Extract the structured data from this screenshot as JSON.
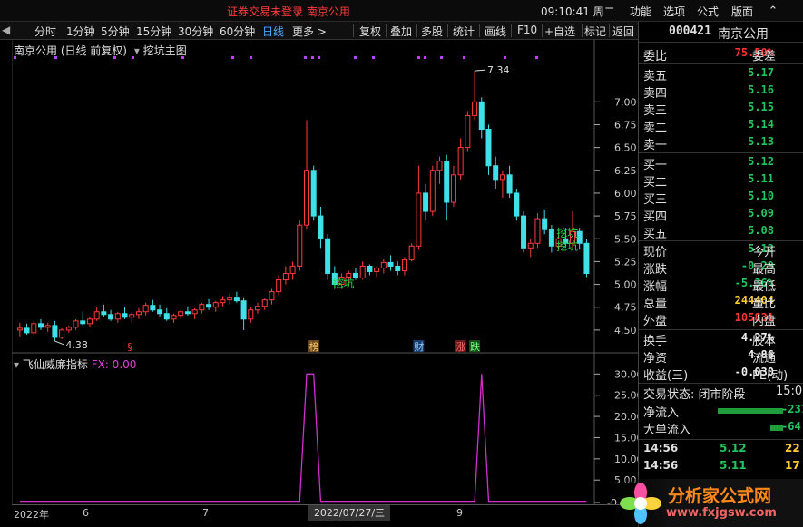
{
  "top": {
    "login_status": "证券交易未登录  南京公用",
    "clock": "09:10:41 周二",
    "menus": [
      "功能",
      "选项",
      "公式",
      "版面"
    ],
    "window_controls": [
      "chevron-up-icon",
      "minimize-icon",
      "maximize-icon",
      "close-icon"
    ]
  },
  "toolbar": {
    "periods": [
      "分时",
      "1分钟",
      "5分钟",
      "15分钟",
      "30分钟",
      "60分钟",
      "日线",
      "更多 >"
    ],
    "active_period": "日线",
    "actions": [
      "复权",
      "叠加",
      "多股",
      "统计",
      "画线",
      "F10",
      "+自选",
      "标记",
      "返回"
    ]
  },
  "chart_header": {
    "title": "南京公用 (日线 前复权)",
    "indicator": "挖坑主图"
  },
  "sub_panel": {
    "name": "飞仙威廉指标",
    "fx_label": "FX: 0.00"
  },
  "chart_data": [
    {
      "type": "candlestick",
      "title": "南京公用 (日线 前复权)",
      "price_ticks": [
        7.0,
        6.75,
        6.5,
        6.25,
        6.0,
        5.75,
        5.5,
        5.25,
        5.0,
        4.75,
        4.5
      ],
      "ylim": [
        4.3,
        7.5
      ],
      "max_annotation": "7.34",
      "min_annotation": "4.38",
      "signal_label": "挖坑",
      "marker_labels": [
        "§",
        "榜",
        "财",
        "涨",
        "跌"
      ],
      "ohlc": [
        [
          4.5,
          4.58,
          4.43,
          4.52
        ],
        [
          4.52,
          4.57,
          4.45,
          4.47
        ],
        [
          4.47,
          4.6,
          4.45,
          4.57
        ],
        [
          4.57,
          4.62,
          4.5,
          4.53
        ],
        [
          4.53,
          4.58,
          4.48,
          4.55
        ],
        [
          4.55,
          4.6,
          4.38,
          4.42
        ],
        [
          4.42,
          4.52,
          4.4,
          4.5
        ],
        [
          4.5,
          4.55,
          4.47,
          4.53
        ],
        [
          4.53,
          4.62,
          4.5,
          4.6
        ],
        [
          4.6,
          4.7,
          4.55,
          4.57
        ],
        [
          4.57,
          4.65,
          4.53,
          4.62
        ],
        [
          4.62,
          4.75,
          4.6,
          4.7
        ],
        [
          4.7,
          4.78,
          4.65,
          4.67
        ],
        [
          4.67,
          4.72,
          4.6,
          4.62
        ],
        [
          4.62,
          4.7,
          4.58,
          4.68
        ],
        [
          4.68,
          4.75,
          4.62,
          4.64
        ],
        [
          4.64,
          4.7,
          4.58,
          4.67
        ],
        [
          4.67,
          4.74,
          4.62,
          4.7
        ],
        [
          4.7,
          4.8,
          4.66,
          4.77
        ],
        [
          4.77,
          4.83,
          4.7,
          4.72
        ],
        [
          4.72,
          4.78,
          4.65,
          4.68
        ],
        [
          4.68,
          4.74,
          4.6,
          4.62
        ],
        [
          4.62,
          4.68,
          4.58,
          4.66
        ],
        [
          4.66,
          4.72,
          4.62,
          4.7
        ],
        [
          4.7,
          4.76,
          4.66,
          4.68
        ],
        [
          4.68,
          4.74,
          4.62,
          4.72
        ],
        [
          4.72,
          4.8,
          4.68,
          4.78
        ],
        [
          4.78,
          4.84,
          4.72,
          4.75
        ],
        [
          4.75,
          4.82,
          4.7,
          4.8
        ],
        [
          4.8,
          4.87,
          4.76,
          4.83
        ],
        [
          4.83,
          4.9,
          4.78,
          4.86
        ],
        [
          4.86,
          4.92,
          4.8,
          4.82
        ],
        [
          4.82,
          4.86,
          4.5,
          4.62
        ],
        [
          4.62,
          4.75,
          4.58,
          4.72
        ],
        [
          4.72,
          4.8,
          4.68,
          4.76
        ],
        [
          4.76,
          4.85,
          4.72,
          4.83
        ],
        [
          4.83,
          4.95,
          4.78,
          4.92
        ],
        [
          4.92,
          5.1,
          4.88,
          5.05
        ],
        [
          5.05,
          5.2,
          5.0,
          5.12
        ],
        [
          5.12,
          5.25,
          5.05,
          5.2
        ],
        [
          5.2,
          5.7,
          5.15,
          5.65
        ],
        [
          5.65,
          6.8,
          5.6,
          6.25
        ],
        [
          6.25,
          6.3,
          5.7,
          5.75
        ],
        [
          5.75,
          5.85,
          5.4,
          5.5
        ],
        [
          5.5,
          5.55,
          5.05,
          5.12
        ],
        [
          5.12,
          5.2,
          4.95,
          5.0
        ],
        [
          5.0,
          5.12,
          4.95,
          5.08
        ],
        [
          5.08,
          5.15,
          5.02,
          5.12
        ],
        [
          5.12,
          5.18,
          5.05,
          5.07
        ],
        [
          5.07,
          5.25,
          5.05,
          5.2
        ],
        [
          5.2,
          5.22,
          5.1,
          5.14
        ],
        [
          5.14,
          5.2,
          5.08,
          5.18
        ],
        [
          5.18,
          5.28,
          5.12,
          5.24
        ],
        [
          5.24,
          5.32,
          5.15,
          5.2
        ],
        [
          5.2,
          5.25,
          5.1,
          5.15
        ],
        [
          5.15,
          5.3,
          5.1,
          5.27
        ],
        [
          5.27,
          5.45,
          5.25,
          5.42
        ],
        [
          5.42,
          6.3,
          5.38,
          6.0
        ],
        [
          6.0,
          6.1,
          5.7,
          5.8
        ],
        [
          5.8,
          6.3,
          5.75,
          6.25
        ],
        [
          6.25,
          6.4,
          6.1,
          6.35
        ],
        [
          6.35,
          6.42,
          5.7,
          5.9
        ],
        [
          5.9,
          6.3,
          5.85,
          6.2
        ],
        [
          6.2,
          6.6,
          6.15,
          6.5
        ],
        [
          6.5,
          6.9,
          6.45,
          6.85
        ],
        [
          6.85,
          7.34,
          6.8,
          7.0
        ],
        [
          7.0,
          7.05,
          6.6,
          6.7
        ],
        [
          6.7,
          6.75,
          6.2,
          6.3
        ],
        [
          6.3,
          6.4,
          6.05,
          6.15
        ],
        [
          6.15,
          6.25,
          5.95,
          6.2
        ],
        [
          6.2,
          6.3,
          5.95,
          6.0
        ],
        [
          6.0,
          6.05,
          5.7,
          5.75
        ],
        [
          5.75,
          5.8,
          5.35,
          5.4
        ],
        [
          5.4,
          5.5,
          5.3,
          5.45
        ],
        [
          5.45,
          5.78,
          5.4,
          5.72
        ],
        [
          5.72,
          5.82,
          5.55,
          5.6
        ],
        [
          5.6,
          5.65,
          5.35,
          5.42
        ],
        [
          5.42,
          5.55,
          5.38,
          5.5
        ],
        [
          5.5,
          5.62,
          5.4,
          5.45
        ],
        [
          5.45,
          5.8,
          5.4,
          5.58
        ],
        [
          5.58,
          5.62,
          5.38,
          5.45
        ],
        [
          5.45,
          5.5,
          5.08,
          5.12
        ]
      ]
    },
    {
      "type": "line",
      "title": "飞仙威廉指标",
      "series_label": "FX: 0.00",
      "y_ticks": [
        30.0,
        25.0,
        20.0,
        15.0,
        10.0,
        5.0,
        -0.3
      ],
      "ylim": [
        -0.3,
        30.5
      ],
      "values": [
        0,
        0,
        0,
        0,
        0,
        0,
        0,
        0,
        0,
        0,
        0,
        0,
        0,
        0,
        0,
        0,
        0,
        0,
        0,
        0,
        0,
        0,
        0,
        0,
        0,
        0,
        0,
        0,
        0,
        0,
        0,
        0,
        0,
        0,
        0,
        0,
        0,
        0,
        0,
        0,
        0,
        30,
        30,
        0,
        0,
        0,
        0,
        0,
        0,
        0,
        0,
        0,
        0,
        0,
        0,
        0,
        0,
        0,
        0,
        0,
        0,
        0,
        0,
        0,
        0,
        0,
        30,
        0,
        0,
        0,
        0,
        0,
        0,
        0,
        0,
        0,
        0,
        0,
        0,
        0,
        0,
        0
      ]
    }
  ],
  "x_axis": {
    "labels": [
      "2022年",
      "6",
      "7",
      "2022/07/27/三",
      "9"
    ]
  },
  "right_panel": {
    "code": "000421",
    "name": "南京公用",
    "weibi_label": "委比",
    "weibi_value": "75.50%",
    "weicha_label": "委差",
    "asks": [
      {
        "label": "卖五",
        "price": "5.17"
      },
      {
        "label": "卖四",
        "price": "5.16"
      },
      {
        "label": "卖三",
        "price": "5.15"
      },
      {
        "label": "卖二",
        "price": "5.14"
      },
      {
        "label": "卖一",
        "price": "5.13"
      }
    ],
    "bids": [
      {
        "label": "买一",
        "price": "5.12"
      },
      {
        "label": "买二",
        "price": "5.11"
      },
      {
        "label": "买三",
        "price": "5.10"
      },
      {
        "label": "买四",
        "price": "5.09"
      },
      {
        "label": "买五",
        "price": "5.08"
      }
    ],
    "quote": [
      {
        "l": "现价",
        "v": "5.12",
        "r": "今开",
        "c": "green"
      },
      {
        "l": "涨跌",
        "v": "-0.29",
        "r": "最高",
        "c": "green"
      },
      {
        "l": "涨幅",
        "v": "-5.36%",
        "r": "最低",
        "c": "green"
      },
      {
        "l": "总量",
        "v": "244404",
        "r": "量比",
        "c": "yel"
      },
      {
        "l": "外盘",
        "v": "105831",
        "r": "内盘",
        "c": "red"
      }
    ],
    "fund": [
      {
        "l": "换手",
        "v": "4.27%",
        "r": "股本",
        "c": "wht"
      },
      {
        "l": "净资",
        "v": "4.86",
        "r": "流通",
        "c": "wht"
      },
      {
        "l": "收益(三)",
        "v": "-0.030",
        "r": "PE(动)",
        "c": "wht"
      }
    ],
    "trade_state": "交易状态: 闭市阶段",
    "trade_state_time": "15:0",
    "netflow_label": "净流入",
    "netflow_value": "-237",
    "bigflow_label": "大单流入",
    "bigflow_value": "-64.",
    "ticks": [
      {
        "t": "14:56",
        "p": "5.12",
        "v": "22"
      },
      {
        "t": "14:56",
        "p": "5.11",
        "v": "17"
      }
    ]
  },
  "watermark": {
    "text": "分析家公式网",
    "url": "www.fxjgsw.com"
  }
}
